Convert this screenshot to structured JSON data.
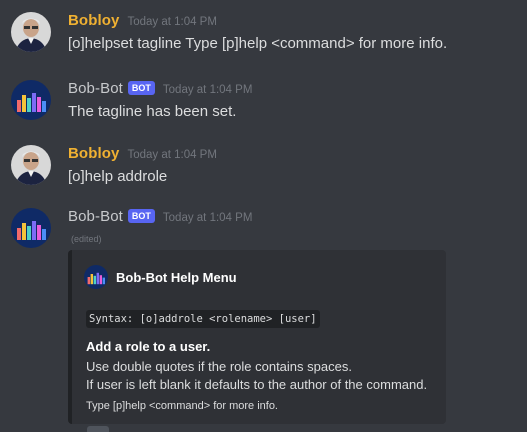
{
  "messages": [
    {
      "username": "Bobloy",
      "timestamp": "Today at 1:04 PM",
      "text": "[o]helpset tagline Type [p]help <command> for more info."
    },
    {
      "username": "Bob-Bot",
      "bot_tag": "BOT",
      "timestamp": "Today at 1:04 PM",
      "text": "The tagline has been set."
    },
    {
      "username": "Bobloy",
      "timestamp": "Today at 1:04 PM",
      "text": "[o]help addrole"
    },
    {
      "username": "Bob-Bot",
      "bot_tag": "BOT",
      "timestamp": "Today at 1:04 PM",
      "edited": "(edited)",
      "embed": {
        "author": "Bob-Bot Help Menu",
        "syntax": "Syntax: [o]addrole <rolename> [user]",
        "title": "Add a role to a user.",
        "description_lines": [
          "Use double quotes if the role contains spaces.",
          "If user is left blank it defaults to the author of the command."
        ],
        "footer": "Type [p]help <command> for more info."
      }
    }
  ],
  "colors": {
    "background": "#36393f",
    "bobloy_name": "#f0b132",
    "bot_tag": "#5865f2",
    "embed_bg": "#2f3136",
    "timestamp": "#72767d"
  }
}
